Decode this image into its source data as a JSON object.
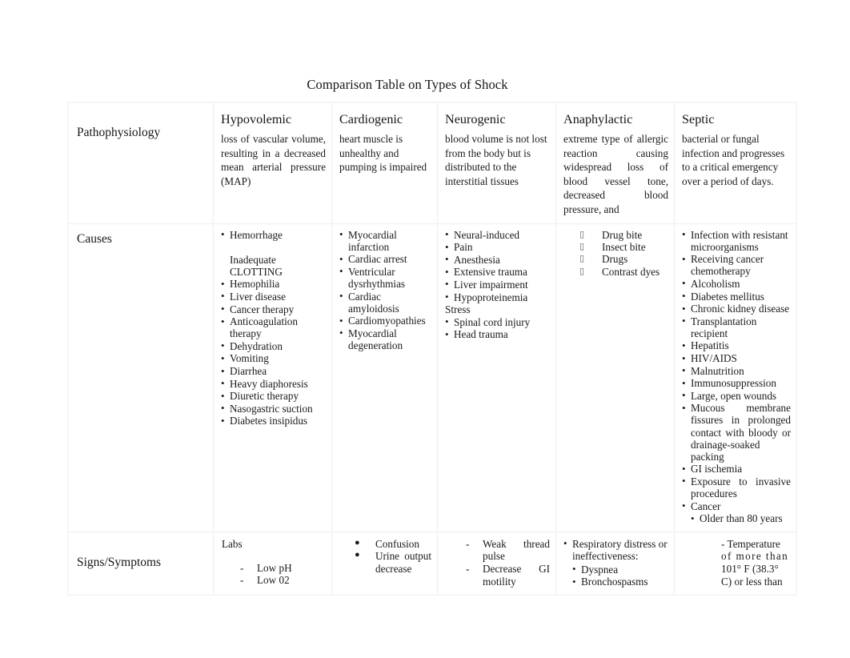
{
  "document": {
    "title": "Comparison Table on Types of Shock"
  },
  "table": {
    "row_labels": {
      "pathophysiology": "Pathophysiology",
      "causes": "Causes",
      "signs_symptoms": "Signs/Symptoms"
    },
    "column_headers": [
      "Hypovolemic",
      "Cardiogenic",
      "Neurogenic",
      "Anaphylactic",
      "Septic"
    ],
    "pathophysiology": {
      "hypovolemic": "loss of vascular volume, resulting in a decreased mean arterial pressure (MAP)",
      "cardiogenic": "heart muscle is unhealthy and pumping is impaired",
      "neurogenic": " blood volume is not lost from the body but is distributed to the interstitial tissues",
      "anaphylactic": "extreme type of allergic reaction causing widespread loss of blood vessel tone, decreased blood pressure, and",
      "septic": "bacterial or fungal infection and progresses to a critical emergency over a period of days."
    },
    "causes": {
      "hypovolemic": [
        "Hemorrhage",
        "",
        "Inadequate CLOTTING",
        "Hemophilia",
        "Liver disease",
        "Cancer therapy",
        "Anticoagulation therapy",
        "Dehydration",
        "Vomiting",
        "Diarrhea",
        "Heavy diaphoresis",
        "Diuretic therapy",
        "Nasogastric suction",
        "Diabetes insipidus"
      ],
      "cardiogenic": [
        "Myocardial infarction",
        "Cardiac arrest",
        "Ventricular dysrhythmias",
        "Cardiac amyloidosis",
        "Cardiomyopathies",
        "Myocardial degeneration"
      ],
      "neurogenic": [
        "Neural-induced",
        "Pain",
        "Anesthesia",
        "Extensive trauma",
        "Liver impairment",
        "Hypoproteinemia",
        "Stress",
        "Spinal cord injury",
        "Head trauma"
      ],
      "anaphylactic": [
        "Drug bite",
        "Insect bite",
        "Drugs",
        "Contrast dyes"
      ],
      "septic": [
        "Infection with resistant microorganisms",
        "Receiving cancer chemotherapy",
        "Alcoholism",
        "Diabetes mellitus",
        "Chronic kidney disease",
        "Transplantation recipient",
        "Hepatitis",
        "HIV/AIDS",
        "Malnutrition",
        "Immunosuppression",
        "Large, open wounds",
        "Mucous membrane fissures in prolonged contact with bloody or drainage-soaked packing",
        "GI ischemia",
        " Exposure to invasive procedures",
        "Cancer",
        "Older than 80 years"
      ]
    },
    "signs_symptoms": {
      "hypovolemic": {
        "heading": "Labs",
        "items": [
          "Low pH",
          "Low 02"
        ]
      },
      "cardiogenic": [
        "Confusion",
        "Urine output decrease"
      ],
      "neurogenic": [
        "Weak thread pulse",
        "Decrease GI motility"
      ],
      "anaphylactic": {
        "heading": "Respiratory distress or ineffectiveness:",
        "items": [
          "Dyspnea",
          "Bronchospasms"
        ]
      },
      "septic": {
        "line1": "- Temperature",
        "line2": "of more than",
        "line3": "101° F (38.3°",
        "line4": "C) or less than"
      }
    }
  },
  "colors": {
    "text": "#1a1a1a",
    "border": "#f2f2f2",
    "background": "#ffffff"
  }
}
